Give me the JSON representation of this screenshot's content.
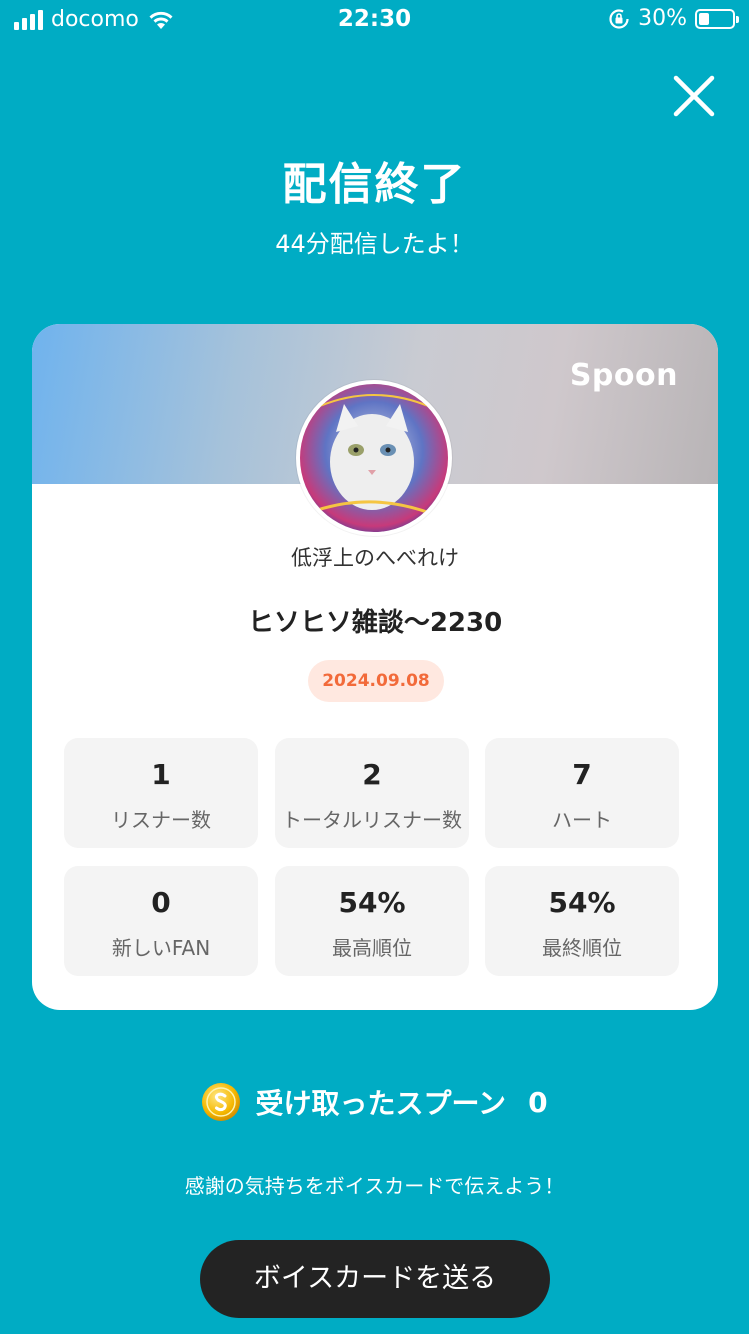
{
  "status_bar": {
    "carrier": "docomo",
    "time": "22:30",
    "battery_percent": "30%",
    "battery_level": 0.3
  },
  "header": {
    "title": "配信終了",
    "subtitle": "44分配信したよ！",
    "close_icon": "close-icon"
  },
  "card": {
    "brand": "Spoon",
    "host_name": "低浮上のへべれけ",
    "live_title": "ヒソヒソ雑談～2230",
    "date": "2024.09.08",
    "stats": [
      {
        "value": "1",
        "label": "リスナー数"
      },
      {
        "value": "2",
        "label": "トータルリスナー数"
      },
      {
        "value": "7",
        "label": "ハート"
      },
      {
        "value": "0",
        "label": "新しいFAN"
      },
      {
        "value": "54%",
        "label": "最高順位"
      },
      {
        "value": "54%",
        "label": "最終順位"
      }
    ]
  },
  "spoons": {
    "label": "受け取ったスプーン",
    "count": "0",
    "icon": "spoon-coin-icon"
  },
  "footer": {
    "thanks_text": "感謝の気持ちをボイスカードで伝えよう！",
    "voice_card_button": "ボイスカードを送る"
  },
  "colors": {
    "background": "#00acc4",
    "date_text": "#f26a3a",
    "date_bg": "#ffe8e0",
    "button_bg": "#232323"
  }
}
